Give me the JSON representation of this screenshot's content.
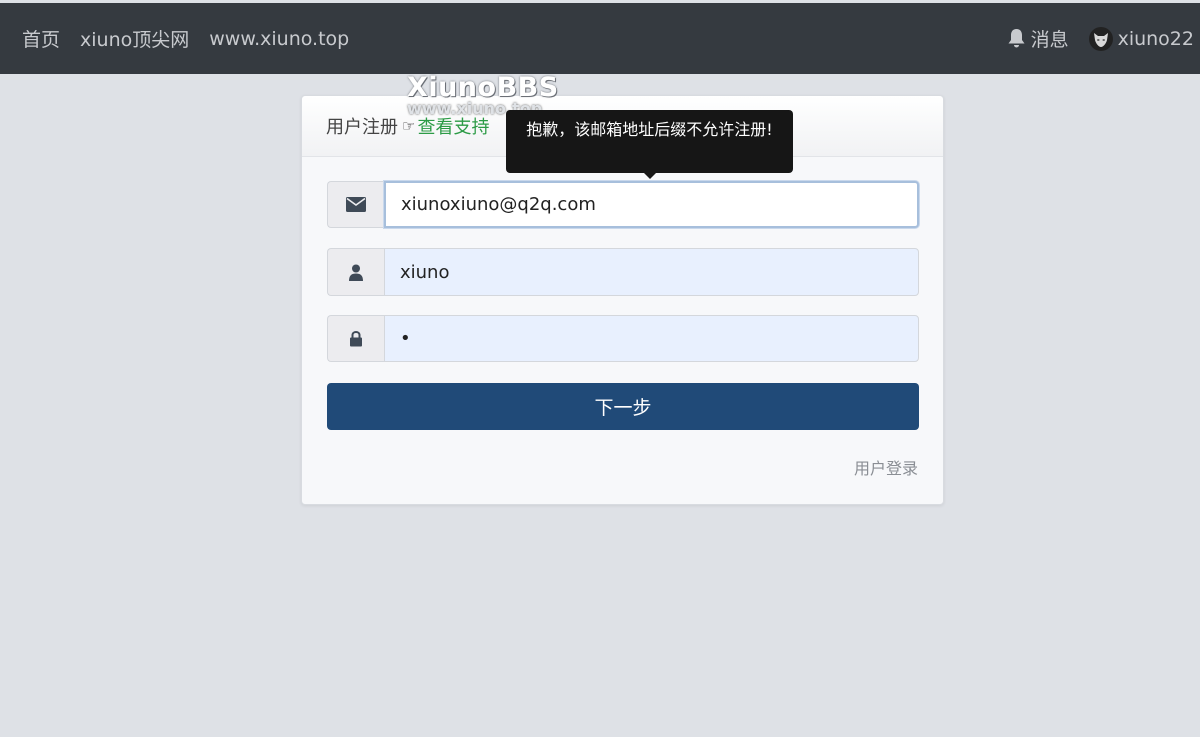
{
  "nav": {
    "left": [
      {
        "label": "首页"
      },
      {
        "label": "xiuno顶尖网"
      },
      {
        "label": "www.xiuno.top"
      }
    ],
    "messages_label": "消息",
    "username": "xiuno22"
  },
  "watermark": {
    "brand": "XiunoBBS",
    "url": "www.xiuno.top"
  },
  "card": {
    "title": "用户注册",
    "support_link": "查看支持"
  },
  "tooltip": {
    "text": "抱歉，该邮箱地址后缀不允许注册!"
  },
  "form": {
    "email_value": "xiunoxiuno@q2q.com",
    "username_value": "xiuno",
    "password_value": "•",
    "next_label": "下一步",
    "login_link": "用户登录"
  },
  "icons": {
    "email": "envelope-icon",
    "user": "user-icon",
    "password": "lock-icon",
    "messages": "bell-icon"
  },
  "colors": {
    "topbar": "#353a40",
    "primary_button": "#204a78",
    "support_link": "#2c9b46",
    "tooltip_bg": "#161616"
  }
}
